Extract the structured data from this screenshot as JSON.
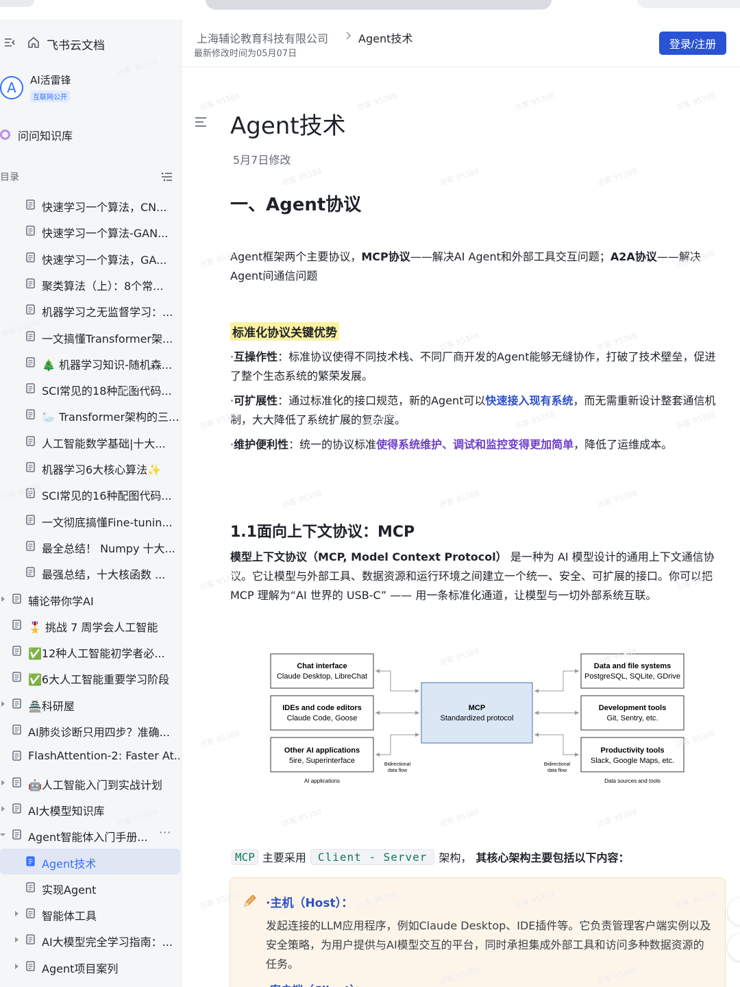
{
  "sidebar": {
    "brand": "飞书云文档",
    "space_avatar": "A",
    "space_name": "AI活雷锋",
    "space_badge": "互联网公开",
    "knowledge_base": "问问知识库",
    "toc_label": "目录",
    "items": [
      {
        "label": "快速学习一个算法，CN...",
        "has_arrow": false
      },
      {
        "label": "快速学习一个算法-GAN...",
        "has_arrow": false
      },
      {
        "label": "快速学习一个算法，GA...",
        "has_arrow": false
      },
      {
        "label": "聚类算法（上）：8个常...",
        "has_arrow": false
      },
      {
        "label": "机器学习之无监督学习：...",
        "has_arrow": false
      },
      {
        "label": "一文搞懂Transformer架...",
        "has_arrow": false
      },
      {
        "label": "🎄 机器学习知识-随机森...",
        "has_arrow": false
      },
      {
        "label": "SCI常见的18种配图代码...",
        "has_arrow": false
      },
      {
        "label": "🦢 Transformer架构的三...",
        "has_arrow": false
      },
      {
        "label": "人工智能数学基础|十大...",
        "has_arrow": false
      },
      {
        "label": "机器学习6大核心算法✨",
        "has_arrow": false
      },
      {
        "label": "SCI常见的16种配图代码...",
        "has_arrow": false
      },
      {
        "label": "一文彻底搞懂Fine-tunin...",
        "has_arrow": false
      },
      {
        "label": "最全总结！ Numpy 十大...",
        "has_arrow": false
      },
      {
        "label": "最强总结，十大核函数 ...",
        "has_arrow": false
      },
      {
        "label": "辅论带你学AI",
        "has_arrow": true
      },
      {
        "label": "🎖️ 挑战 7 周学会人工智能",
        "has_arrow": false
      },
      {
        "label": "✅12种人工智能初学者必...",
        "has_arrow": false
      },
      {
        "label": "✅6大人工智能重要学习阶段",
        "has_arrow": false
      },
      {
        "label": "🏯科研屋",
        "has_arrow": true
      },
      {
        "label": "AI肺炎诊断只用四步？准确...",
        "has_arrow": false
      },
      {
        "label": "FlashAttention-2: Faster At...",
        "has_arrow": false
      },
      {
        "label": "🤖人工智能入门到实战计划",
        "has_arrow": true
      },
      {
        "label": "AI大模型知识库",
        "has_arrow": true
      },
      {
        "label": "Agent智能体入门手册...",
        "has_arrow": true,
        "more": "···"
      },
      {
        "label": "Agent技术",
        "has_arrow": false,
        "active": true
      },
      {
        "label": "实现Agent",
        "has_arrow": false
      },
      {
        "label": "智能体工具",
        "has_arrow": true
      },
      {
        "label": "AI大模型完全学习指南：...",
        "has_arrow": true
      },
      {
        "label": "Agent项目案列",
        "has_arrow": true
      }
    ]
  },
  "header": {
    "breadcrumb_parent": "上海辅论教育科技有限公司",
    "breadcrumb_current": "Agent技术",
    "modified": "最新修改时间为05月07日",
    "login": "登录/注册"
  },
  "doc": {
    "title": "Agent技术",
    "date": "5月7日修改",
    "h1": "一、Agent协议",
    "intro": {
      "p1": "Agent框架两个主要协议，",
      "b1": "MCP协议",
      "p2": "——解决AI Agent和外部工具交互问题；",
      "b2": "A2A协议",
      "p3": "——解决Agent间通信问题"
    },
    "highlight": "标准化协议关键优势",
    "bullets": {
      "interop_label": "互操作性",
      "interop_text": "：标准协议使得不同技术栈、不同厂商开发的Agent能够无缝协作，打破了技术壁垒，促进了整个生态系统的繁荣发展。",
      "scal_label": "可扩展性",
      "scal_text1": "：通过标准化的接口规范，新的Agent可以",
      "scal_blue": "快速接入现有系统",
      "scal_text2": "，而无需重新设计整套通信机制，大大降低了系统扩展的复杂度。",
      "maint_label": "维护便利性",
      "maint_text1": "：统一的协议标准",
      "maint_purple": "使得系统维护、调试和监控变得更加简单",
      "maint_text2": "，降低了运维成本。"
    },
    "h2": "1.1面向上下文协议：MCP",
    "mcp_para": {
      "bold": "模型上下文协议（MCP, Model Context Protocol）",
      "rest": " 是一种为 AI 模型设计的通用上下文通信协议。它让模型与外部工具、数据资源和运行环境之间建立一个统一、安全、可扩展的接口。你可以把 MCP 理解为“AI 世界的 USB-C” —— 用一条标准化通道，让模型与一切外部系统互联。"
    },
    "diagram": {
      "left": [
        {
          "title": "Chat interface",
          "sub": "Claude Desktop, LibreChat"
        },
        {
          "title": "IDEs and code editors",
          "sub": "Claude Code, Goose"
        },
        {
          "title": "Other AI applications",
          "sub": "5ire, Superinterface"
        }
      ],
      "center": {
        "title": "MCP",
        "sub": "Standardized protocol"
      },
      "right": [
        {
          "title": "Data and file systems",
          "sub": "PostgreSQL, SQLite, GDrive"
        },
        {
          "title": "Development tools",
          "sub": "Git, Sentry, etc."
        },
        {
          "title": "Productivity tools",
          "sub": "Slack, Google Maps, etc."
        }
      ],
      "left_caption": "AI applications",
      "right_caption": "Data sources and tools",
      "flow_left_1": "Bidirectional",
      "flow_left_2": "data flow",
      "flow_right_1": "Bidirectional",
      "flow_right_2": "data flow"
    },
    "arch": {
      "code1": "MCP",
      "t1": "主要采用",
      "code2": "Client - Server",
      "t2": "架构，",
      "bold": "其核心架构主要包括以下内容："
    },
    "callout": {
      "head": "·主机（Host）：",
      "body": "发起连接的LLM应用程序，例如Claude Desktop、IDE插件等。它负责管理客户端实例以及安全策略，为用户提供与AI模型交互的平台，同时承担集成外部工具和访问多种数据资源的任务。",
      "next": "客户端（Client）："
    }
  },
  "colors": {
    "accent": "#2952d4",
    "link_blue": "#2d50c8",
    "purple": "#6d3fc7",
    "highlight": "#fbf1a0",
    "active_bg": "#e1e6f5"
  },
  "icons": [
    "collapse-icon",
    "home-icon",
    "toc-list-icon",
    "document-icon",
    "chevron-right-icon",
    "menu-icon",
    "pen-icon"
  ]
}
